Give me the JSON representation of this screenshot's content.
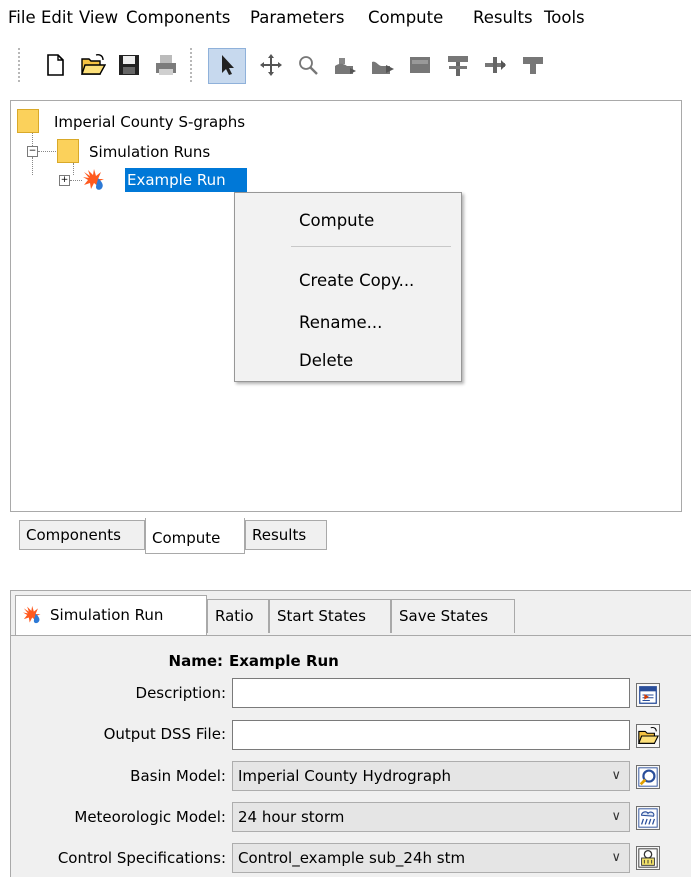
{
  "menu": [
    "File",
    "Edit",
    "View",
    "Components",
    "Parameters",
    "Compute",
    "Results",
    "Tools"
  ],
  "toolbar": {
    "icons": [
      "new-file-icon",
      "open-folder-icon",
      "save-icon",
      "print-icon",
      "arrow-select-icon",
      "move-icon",
      "zoom-icon",
      "add-subbasin-icon",
      "add-reach-icon",
      "add-reservoir-icon",
      "add-junction-icon",
      "add-diversion-icon",
      "add-sink-icon"
    ]
  },
  "tree": {
    "root": "Imperial County S-graphs",
    "simulation_runs": "Simulation Runs",
    "run": "Example Run"
  },
  "context_menu": {
    "compute": "Compute",
    "create_copy": "Create Copy...",
    "rename": "Rename...",
    "delete": "Delete"
  },
  "tree_tabs": [
    "Components",
    "Compute",
    "Results"
  ],
  "lower_tabs": [
    "Simulation Run",
    "Ratio",
    "Start States",
    "Save States"
  ],
  "form": {
    "name_label": "Name:",
    "name_value": "Example Run",
    "description_label": "Description:",
    "description_value": "",
    "output_dss_label": "Output DSS File:",
    "output_dss_value": "",
    "basin_label": "Basin Model:",
    "basin_value": "Imperial County Hydrograph",
    "met_label": "Meteorologic Model:",
    "met_value": "24 hour storm",
    "control_label": "Control Specifications:",
    "control_value": "Control_example sub_24h stm"
  },
  "colors": {
    "selection": "#0078d7",
    "folder": "#fbd15b",
    "panel": "#f0f0f0"
  }
}
